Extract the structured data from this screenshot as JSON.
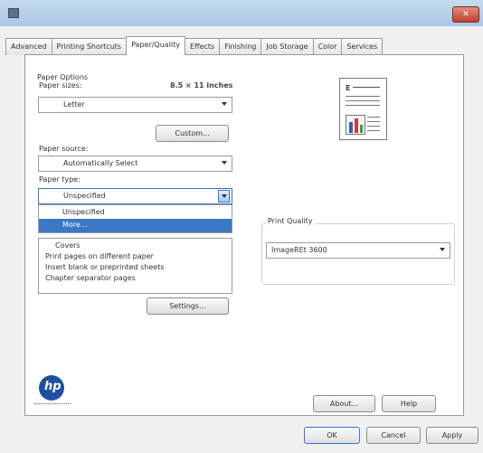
{
  "window": {
    "close_label": "✕"
  },
  "tabs": [
    "Advanced",
    "Printing Shortcuts",
    "Paper/Quality",
    "Effects",
    "Finishing",
    "Job Storage",
    "Color",
    "Services"
  ],
  "paper_options": {
    "group_label": "Paper Options",
    "paper_sizes_label": "Paper sizes:",
    "paper_size_value": "8.5 × 11 inches",
    "paper_size_select": "Letter",
    "custom_button": "Custom...",
    "paper_source_label": "Paper source:",
    "paper_source_value": "Automatically Select",
    "paper_type_label": "Paper type:",
    "paper_type_value": "Unspecified",
    "dropdown_items": [
      "Unspecified",
      "More..."
    ],
    "special_pages_items": [
      "Covers",
      "Print pages on different paper",
      "Insert blank or preprinted sheets",
      "Chapter separator pages"
    ],
    "settings_button": "Settings..."
  },
  "print_quality": {
    "label": "Print Quality",
    "value": "ImageREt 3600"
  },
  "footer": {
    "about_button": "About...",
    "help_button": "Help",
    "ok_button": "OK",
    "cancel_button": "Cancel",
    "apply_button": "Apply"
  },
  "colors": {
    "selection": "#3a78c5",
    "hp_logo": "#1f4fa0"
  }
}
